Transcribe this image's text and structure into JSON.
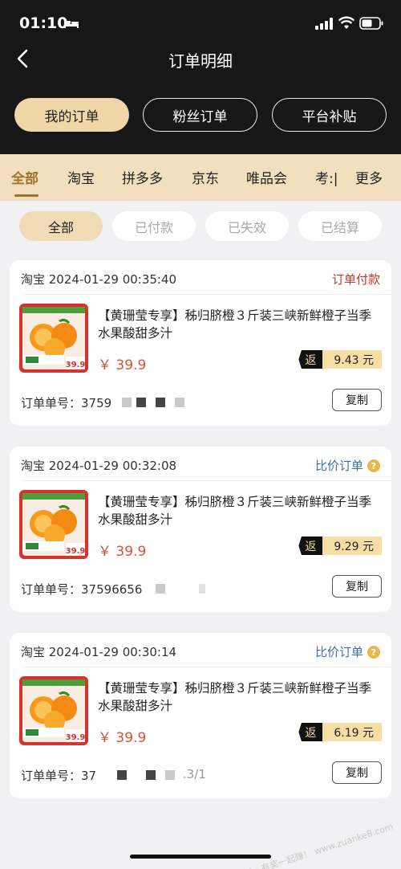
{
  "status_bar": {
    "time": "01:10"
  },
  "header": {
    "title": "订单明细"
  },
  "top_tabs": [
    {
      "label": "我的订单",
      "active": true
    },
    {
      "label": "粉丝订单",
      "active": false
    },
    {
      "label": "平台补贴",
      "active": false
    }
  ],
  "categories": [
    "全部",
    "淘宝",
    "拼多多",
    "京东",
    "唯品会",
    "考:|",
    "更多"
  ],
  "active_category": "全部",
  "filters": [
    {
      "label": "全部",
      "active": true
    },
    {
      "label": "已付款",
      "active": false
    },
    {
      "label": "已失效",
      "active": false
    },
    {
      "label": "已结算",
      "active": false
    }
  ],
  "orders": [
    {
      "header": "淘宝 2024-01-29 00:35:40",
      "status": "订单付款",
      "status_color": "#c0392b",
      "title": "【黄珊莹专享】秭归脐橙３斤装三峡新鲜橙子当季水果酸甜多汁",
      "price": "￥ 39.9",
      "rebate_label": "返",
      "rebate_amount": "9.43 元",
      "order_no_label": "订单单号：",
      "order_no": "3759",
      "copy_label": "复制",
      "thumb_price": "39.9"
    },
    {
      "header": "淘宝 2024-01-29 00:32:08",
      "status": "比价订单",
      "status_color": "#3d6fb5",
      "title": "【黄珊莹专享】秭归脐橙３斤装三峡新鲜橙子当季水果酸甜多汁",
      "price": "￥ 39.9",
      "rebate_label": "返",
      "rebate_amount": "9.29 元",
      "order_no_label": "订单单号：",
      "order_no": "37596656",
      "copy_label": "复制",
      "thumb_price": "39.9"
    },
    {
      "header": "淘宝 2024-01-29 00:30:14",
      "status": "比价订单",
      "status_color": "#3d6fb5",
      "title": "【黄珊莹专享】秭归脐橙３斤装三峡新鲜橙子当季水果酸甜多汁",
      "price": "￥ 39.9",
      "rebate_label": "返",
      "rebate_amount": "6.19 元",
      "order_no_label": "订单单号：",
      "order_no": "37",
      "order_no_tail": ".3/1",
      "copy_label": "复制",
      "thumb_price": "39.9"
    }
  ],
  "watermark": "赚客吧，有奖一起赚！ www.zuanke8.com",
  "colors": {
    "header_bg": "#171717",
    "accent_gold": "#f0d7a8",
    "category_bg": "#f2dfbd",
    "price_red": "#d0553b"
  }
}
